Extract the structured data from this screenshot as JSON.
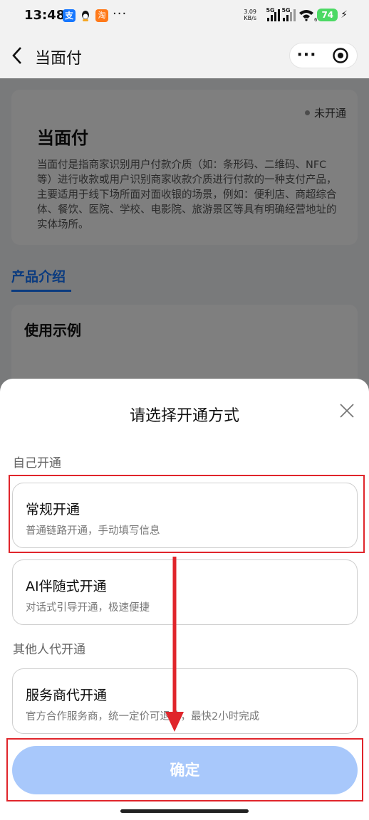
{
  "status_bar": {
    "time": "13:48",
    "app_icons": [
      "alipay-icon",
      "qq-icon",
      "taobao-icon"
    ],
    "more": "···",
    "net_speed_value": "3.09",
    "net_speed_unit": "KB/s",
    "signal_1_label": "5G",
    "signal_2_label": "5G",
    "wifi_label": "6",
    "battery": "74"
  },
  "nav": {
    "title": "当面付",
    "more_label": "···"
  },
  "background": {
    "card": {
      "status": "未开通",
      "title": "当面付",
      "description": "当面付是指商家识别用户付款介质（如：条形码、二维码、NFC等）进行收款或用户识别商家收款介质进行付款的一种支付产品，主要适用于线下场所面对面收银的场景，例如：便利店、商超综合体、餐饮、医院、学校、电影院、旅游景区等具有明确经营地址的实体场所。"
    },
    "tab": "产品介绍",
    "section_title": "使用示例"
  },
  "sheet": {
    "title": "请选择开通方式",
    "groups": [
      {
        "label": "自己开通",
        "options": [
          {
            "title": "常规开通",
            "desc": "普通链路开通，手动填写信息"
          },
          {
            "title": "AI伴随式开通",
            "desc": "对话式引导开通，极速便捷"
          }
        ]
      },
      {
        "label": "其他人代开通",
        "options": [
          {
            "title": "服务商代开通",
            "desc": "官方合作服务商，统一定价可退款，最快2小时完成"
          }
        ]
      }
    ],
    "confirm": "确定"
  },
  "colors": {
    "brand_blue": "#1677ff",
    "confirm_disabled": "#a8c8fb",
    "annotation_red": "#e0252b",
    "battery_green": "#4cd964"
  }
}
